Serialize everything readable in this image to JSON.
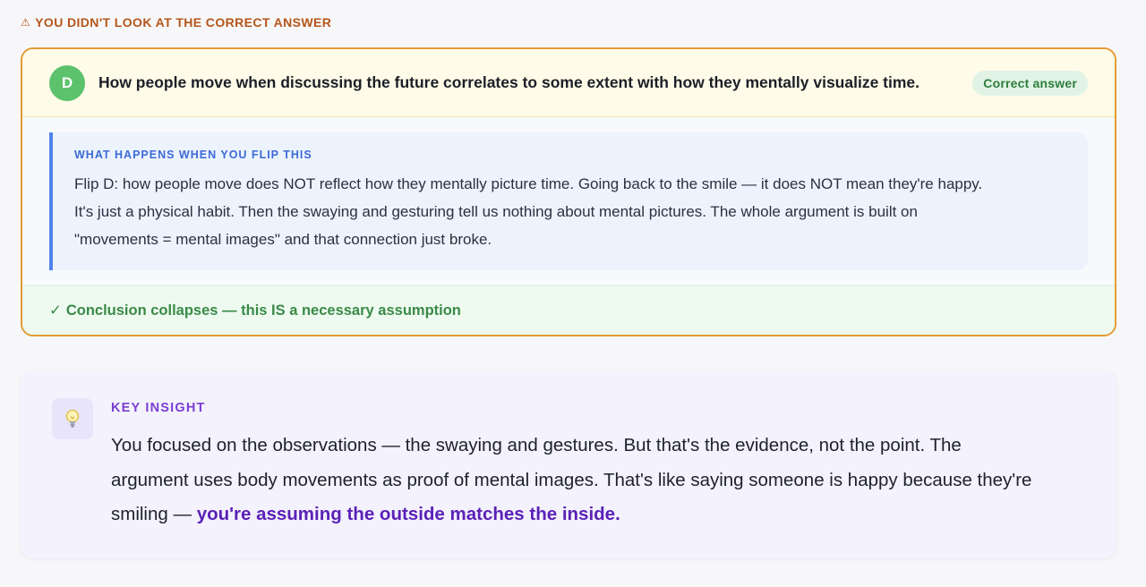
{
  "warning": {
    "icon": "warning-triangle-icon",
    "text": "YOU DIDN'T LOOK AT THE CORRECT ANSWER"
  },
  "answer": {
    "letter": "D",
    "text": "How people move when discussing the future correlates to some extent with how they mentally visualize time.",
    "badge": "Correct answer",
    "flip": {
      "title": "WHAT HAPPENS WHEN YOU FLIP THIS",
      "line1": "Flip D: how people move does NOT reflect how they mentally picture time. Going back to the smile — it does NOT mean they're happy.",
      "line2": "It's just a physical habit. Then the swaying and gesturing tell us nothing about mental pictures. The whole argument is built on",
      "line3": "\"movements = mental images\" and that connection just broke."
    },
    "verdict": {
      "icon": "✓",
      "text": "Conclusion collapses — this IS a necessary assumption"
    }
  },
  "insight": {
    "icon": "lightbulb-icon",
    "title": "KEY INSIGHT",
    "body_line1": "You focused on the observations — the swaying and gestures. But that's the evidence, not the point. The",
    "body_line2": "argument uses body movements as proof of mental images. That's like saying someone is happy because they're",
    "body_line3_plain": "smiling — ",
    "body_line3_emphasis": "you're assuming the outside matches the inside."
  },
  "colors": {
    "warning": "#b5561a",
    "card_border": "#e49b34",
    "correct_badge": "#5cc26c",
    "flip_accent": "#4f82ea",
    "verdict": "#3a8a48",
    "insight_accent": "#7b3fd1",
    "insight_emphasis": "#5b21b6"
  }
}
